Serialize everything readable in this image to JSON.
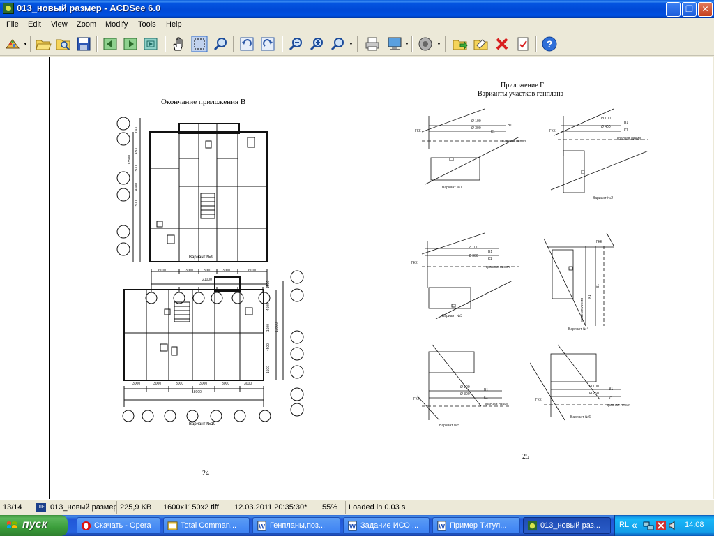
{
  "window": {
    "title": "013_новый размер - ACDSee 6.0"
  },
  "menu": [
    "File",
    "Edit",
    "View",
    "Zoom",
    "Modify",
    "Tools",
    "Help"
  ],
  "toolbar": {
    "items": [
      "acquire-icon",
      "open-folder-icon",
      "browse-icon",
      "save-icon",
      "prev-image-icon",
      "next-image-icon",
      "auto-advance-icon",
      "hand-pan-icon",
      "select-region-icon",
      "zoom-tool-icon",
      "rotate-left-icon",
      "rotate-right-icon",
      "zoom-out-icon",
      "zoom-in-icon",
      "zoom-menu-icon",
      "print-icon",
      "set-wallpaper-icon",
      "audio-icon",
      "copy-to-folder-icon",
      "move-to-folder-icon",
      "delete-icon",
      "properties-icon",
      "help-icon"
    ]
  },
  "document": {
    "left_page": {
      "heading": "Окончание приложения В",
      "caption1": "Вариант №9",
      "caption2": "Вариант №10",
      "page_number": "24",
      "dims_top": [
        "6000",
        "3000",
        "3000",
        "3000",
        "6000"
      ],
      "dims_top_total": "21000",
      "dims_left": [
        "1500",
        "4500",
        "1500",
        "4500",
        "1500"
      ],
      "dims_left_total": "13500",
      "dims_bottom": [
        "3000",
        "3000",
        "3000",
        "3000",
        "3000",
        "3000"
      ],
      "dims_bottom_total": "18000",
      "dims_right": [
        "1500",
        "4500",
        "1500",
        "4500",
        "1500"
      ],
      "dims_right_total": "13500"
    },
    "right_page": {
      "heading_line1": "Приложение Г",
      "heading_line2": "Варианты участков генплана",
      "captions": [
        "Вариант №1",
        "Вариант №2",
        "Вариант №3",
        "Вариант №4",
        "Вариант №5",
        "Вариант №6"
      ],
      "page_number": "25",
      "labels": {
        "gkk": "ГКК",
        "b1": "В1",
        "k1": "К1",
        "d100": "Ø 100",
        "d300": "Ø 300",
        "d400": "Ø 400",
        "red_line": "красная линия"
      }
    }
  },
  "status": {
    "index": "13/14",
    "filename": "013_новый размер",
    "filesize": "225,9 KB",
    "dimensions": "1600x1150x2 tiff",
    "date": "12.03.2011 20:35:30*",
    "zoom": "55%",
    "loaded": "Loaded in 0.03 s"
  },
  "taskbar": {
    "start_label": "пуск",
    "tasks": [
      {
        "label": "Скачать - Opera",
        "icon": "opera-icon"
      },
      {
        "label": "Total Comman...",
        "icon": "total-commander-icon"
      },
      {
        "label": "Генпланы,поз...",
        "icon": "word-doc-icon"
      },
      {
        "label": "Задание ИСО ...",
        "icon": "word-doc-icon"
      },
      {
        "label": "Пример Титул...",
        "icon": "word-doc-icon"
      },
      {
        "label": "013_новый раз...",
        "icon": "acdsee-icon"
      }
    ],
    "language": "RL",
    "clock": "14:08"
  },
  "colors": {
    "titlebar": "#0054e3",
    "taskbar": "#245edb",
    "start": "#3a9d3a"
  }
}
